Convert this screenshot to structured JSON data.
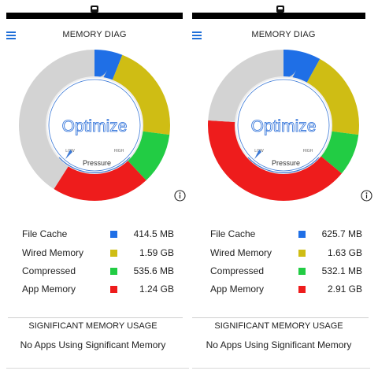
{
  "app": {
    "title": "MEMORY DIAG"
  },
  "icons": {
    "menu": "hamburger-menu-icon",
    "info": "info-circle-icon",
    "status": "camera-notch-icon"
  },
  "colors": {
    "file_cache": "#1f6fe6",
    "wired_memory": "#cfbd14",
    "compressed": "#22cc44",
    "app_memory": "#ee1c1c",
    "free": "#d3d3d3",
    "accent": "#1f6fd8"
  },
  "gauge": {
    "button_label": "Optimize",
    "dial_label": "Pressure",
    "low_label": "LOW",
    "high_label": "HIGH"
  },
  "panels": [
    {
      "legend": [
        {
          "label": "File Cache",
          "value": "414.5 MB",
          "key": "file_cache"
        },
        {
          "label": "Wired Memory",
          "value": "1.59 GB",
          "key": "wired_memory"
        },
        {
          "label": "Compressed",
          "value": "535.6 MB",
          "key": "compressed"
        },
        {
          "label": "App Memory",
          "value": "1.24 GB",
          "key": "app_memory"
        }
      ],
      "significant": {
        "title": "SIGNIFICANT MEMORY USAGE",
        "message": "No Apps Using Significant Memory"
      }
    },
    {
      "legend": [
        {
          "label": "File Cache",
          "value": "625.7 MB",
          "key": "file_cache"
        },
        {
          "label": "Wired Memory",
          "value": "1.63 GB",
          "key": "wired_memory"
        },
        {
          "label": "Compressed",
          "value": "532.1 MB",
          "key": "compressed"
        },
        {
          "label": "App Memory",
          "value": "2.91 GB",
          "key": "app_memory"
        }
      ],
      "significant": {
        "title": "SIGNIFICANT MEMORY USAGE",
        "message": "No Apps Using Significant Memory"
      }
    }
  ],
  "chart_data": [
    {
      "type": "pie",
      "categories": [
        "File Cache",
        "Wired Memory",
        "Compressed",
        "App Memory",
        "Free"
      ],
      "values": [
        6,
        21,
        11,
        21,
        41
      ],
      "unit": "percent of ring (estimated)"
    },
    {
      "type": "pie",
      "categories": [
        "File Cache",
        "Wired Memory",
        "Compressed",
        "App Memory",
        "Free"
      ],
      "values": [
        8,
        19,
        9,
        40,
        24
      ],
      "unit": "percent of ring (estimated)"
    }
  ]
}
